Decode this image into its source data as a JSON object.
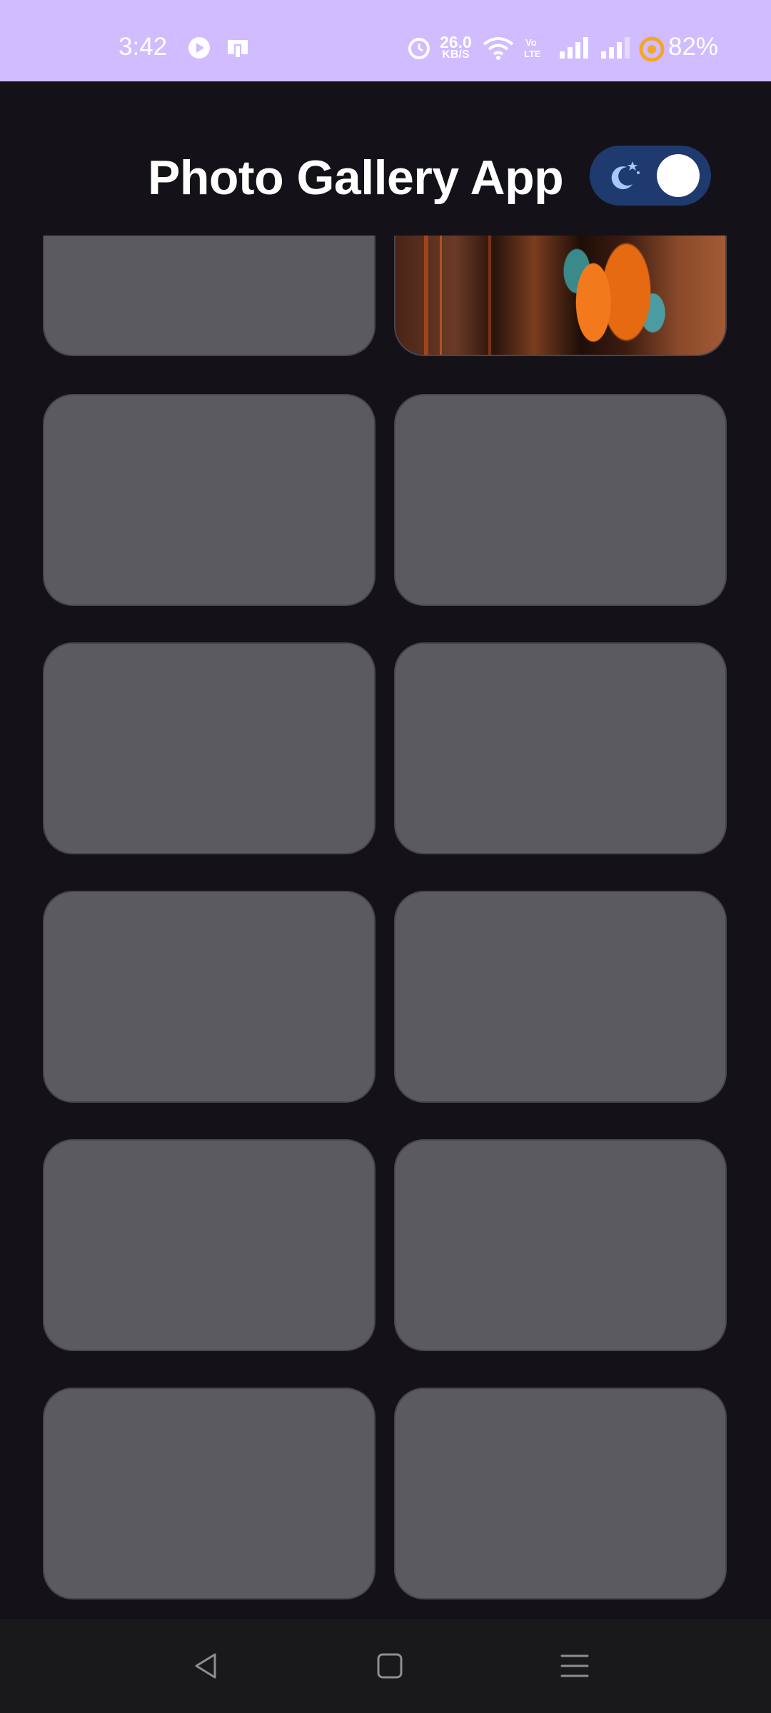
{
  "status_bar": {
    "time": "3:42",
    "net_speed_value": "26.0",
    "net_speed_unit": "KB/S",
    "battery": "82%",
    "background": "#d0bcff"
  },
  "header": {
    "title": "Photo Gallery App",
    "theme_toggle": {
      "icon": "moon-stars-icon",
      "state": "dark mode on"
    }
  },
  "gallery": {
    "tiles": [
      {
        "type": "placeholder"
      },
      {
        "type": "photo"
      },
      {
        "type": "placeholder"
      },
      {
        "type": "placeholder"
      },
      {
        "type": "placeholder"
      },
      {
        "type": "placeholder"
      },
      {
        "type": "placeholder"
      },
      {
        "type": "placeholder"
      },
      {
        "type": "placeholder"
      },
      {
        "type": "placeholder"
      },
      {
        "type": "placeholder"
      },
      {
        "type": "placeholder"
      }
    ]
  },
  "nav_bar": {
    "back_icon": "back-triangle-icon",
    "home_icon": "home-square-icon",
    "recents_icon": "menu-lines-icon"
  }
}
